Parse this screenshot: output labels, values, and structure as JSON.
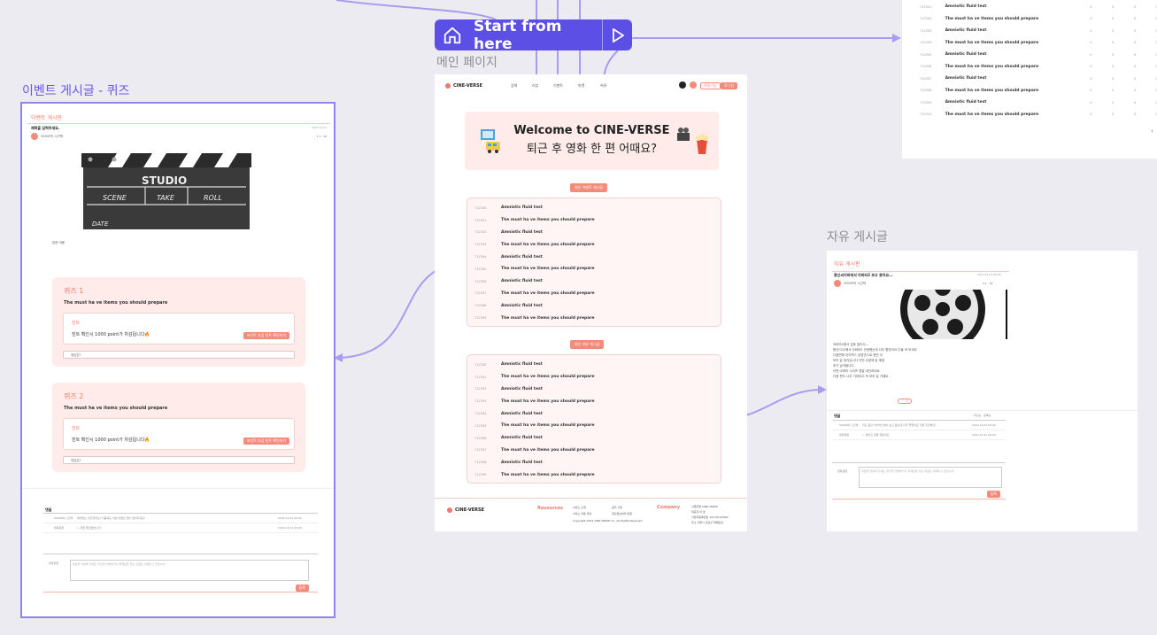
{
  "start_button": {
    "label": "Start from here"
  },
  "frames": {
    "main": {
      "label": "메인 페이지"
    },
    "event": {
      "label": "이벤트 게시글 - 퀴즈"
    },
    "free": {
      "label": "자유 게시글"
    }
  },
  "main_page": {
    "logo": "CINE-VERSE",
    "nav": [
      "검색",
      "리뷰",
      "이벤트",
      "마켓",
      "커뮤"
    ],
    "nav_right": {
      "signup": "회원가입",
      "login": "로그인"
    },
    "welcome_line1": "Welcome to CINE-VERSE",
    "welcome_line2": "퇴근 후 영화 한 편 어때요?",
    "section1_tag": "최신 이벤트 게시글",
    "section2_tag": "최신 자유 게시글",
    "section1_rows": [
      {
        "id": "712300",
        "title": "Amniotic fluid test"
      },
      {
        "id": "712301",
        "title": "The must ha ve items you should prepare"
      },
      {
        "id": "712302",
        "title": "Amniotic fluid test"
      },
      {
        "id": "712303",
        "title": "The must ha ve items you should prepare"
      },
      {
        "id": "712304",
        "title": "Amniotic fluid test"
      },
      {
        "id": "712305",
        "title": "The must ha ve items you should prepare"
      },
      {
        "id": "712306",
        "title": "Amniotic fluid test"
      },
      {
        "id": "712307",
        "title": "The must ha ve items you should prepare"
      },
      {
        "id": "712308",
        "title": "Amniotic fluid test"
      },
      {
        "id": "712309",
        "title": "The must ha ve items you should prepare"
      }
    ],
    "section2_rows": [
      {
        "id": "712300",
        "title": "Amniotic fluid test"
      },
      {
        "id": "712301",
        "title": "The must ha ve items you should prepare"
      },
      {
        "id": "712302",
        "title": "Amniotic fluid test"
      },
      {
        "id": "712303",
        "title": "The must ha ve items you should prepare"
      },
      {
        "id": "712304",
        "title": "Amniotic fluid test"
      },
      {
        "id": "712305",
        "title": "The must ha ve items you should prepare"
      },
      {
        "id": "712306",
        "title": "Amniotic fluid test"
      },
      {
        "id": "712307",
        "title": "The must ha ve items you should prepare"
      },
      {
        "id": "712308",
        "title": "Amniotic fluid test"
      },
      {
        "id": "712309",
        "title": "The must ha ve items you should prepare"
      }
    ],
    "footer": {
      "logo": "CINE-VERSE",
      "resources": "Resources",
      "company": "Company",
      "res_links": [
        "서비스 소개",
        "서비스 이용 약관",
        "공지 사항",
        "개인정보처리 방침"
      ],
      "company_lines": [
        "사업자명 CINE-VERSE",
        "대표자 이 호",
        "사업자등록번호 123-45-67890",
        "주소 서울시 강남구 테헤란로"
      ],
      "copyright": "Copyright 2022 CINE-VERSE Inc. All Rights Reserved"
    }
  },
  "event_post": {
    "board": "이벤트 게시판",
    "title": "제목을 입력하세요.",
    "author": "5000P의 시간택",
    "date": "2022.12.01",
    "counts": "3 1 · 34",
    "clapper": {
      "studio": "STUDIO",
      "scene": "SCENE",
      "take": "TAKE",
      "roll": "ROLL",
      "date": "DATE"
    },
    "body_text": "본문 내용",
    "quizzes": [
      {
        "title": "퀴즈 1",
        "question": "The must ha ve items you should prepare",
        "hint_label": "힌트",
        "hint_text": "힌트 확인시 1000 point가 차감됩니다🔥",
        "hint_button": "포인트 차감 힌트 확인하기",
        "answer_placeholder": "정답은?"
      },
      {
        "title": "퀴즈 2",
        "question": "The must ha ve items you should prepare",
        "hint_label": "힌트",
        "hint_text": "힌트 확인시 1000 point가 차감됩니다🔥",
        "hint_button": "포인트 차감 힌트 확인하기",
        "answer_placeholder": "정답은?"
      }
    ],
    "comments_label": "댓글",
    "comments": [
      {
        "author": "5000P의 시간택",
        "text": "재미있는 퀴즈였어요! 다음에도 이런 이벤트 많이 열어주세요!",
        "date": "2022.12.01 00:00"
      },
      {
        "author": "영화광팬",
        "text": "ㄴ 정답 확인했습니다",
        "date": "2022.12.01 00:00"
      }
    ],
    "comment_author": "영화광팬",
    "comment_placeholder": "댓글을 작성해 주세요. 타인을 비방하거나 불쾌감을 주는 댓글은 삭제될 수 있습니다.",
    "submit": "등록"
  },
  "free_post": {
    "board": "자유 게시판",
    "title": "용산씨지비에서 아바타2 보고 왔어요...",
    "author": "5000P의 시간택",
    "date": "2022.12.01 00:00",
    "counts": "3 1 · 34",
    "body_lines": [
      "아바타2에서 감동 많아서...",
      "용산CGV에서 아바타2 관람했는데 너무 좋았어요 다들 꼭 보세요",
      "다음번에 아이맥스 상영관으로 한번 더",
      "보러 갈 생각입니다 이번 주말에 갈 예정",
      "후기 남겨봅니다.",
      "이번 아바타 시리즈 정말 대단하네요",
      "다음 편도 너무 기대되고 꼭 보러 갈 거예요 ."
    ],
    "like": "♡ 0",
    "comments_label": "댓글",
    "comment_sort": "최신순 · 등록순",
    "comments": [
      {
        "author": "5000P의 시간택",
        "text": "저도 용산 아이맥스에서 보고 왔는데 너무 좋았어요 다들 추천해요!",
        "date": "2022.12.01 00:00"
      },
      {
        "author": "영화광팬",
        "text": "ㄴ 맞아요 정말 재밌어요",
        "date": "2022.12.01 00:00"
      }
    ],
    "comment_author": "영화광팬",
    "comment_placeholder": "댓글을 작성해 주세요. 타인을 비방하거나 불쾌감을 주는 댓글은 삭제될 수 있습니다.",
    "submit": "등록"
  },
  "right_table": {
    "rows": [
      {
        "id": "712301",
        "title": "Amniotic fluid test"
      },
      {
        "id": "712302",
        "title": "The must ha ve items you should prepare"
      },
      {
        "id": "712303",
        "title": "Amniotic fluid test"
      },
      {
        "id": "712304",
        "title": "The must ha ve items you should prepare"
      },
      {
        "id": "712305",
        "title": "Amniotic fluid test"
      },
      {
        "id": "712306",
        "title": "The must ha ve items you should prepare"
      },
      {
        "id": "712307",
        "title": "Amniotic fluid test"
      },
      {
        "id": "712308",
        "title": "The must ha ve items you should prepare"
      },
      {
        "id": "712309",
        "title": "Amniotic fluid test"
      },
      {
        "id": "712310",
        "title": "The must ha ve items you should prepare"
      }
    ],
    "cell": "0",
    "pager": "‹"
  }
}
